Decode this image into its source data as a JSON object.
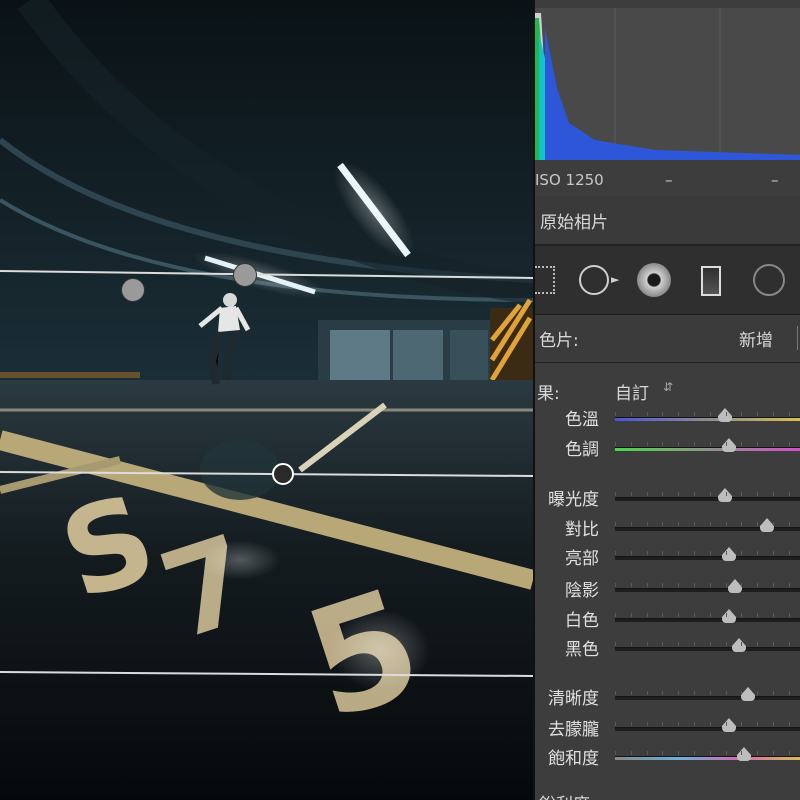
{
  "photo": {
    "description": "",
    "guide_handles": 4
  },
  "panel": {
    "histogram": {
      "colors": [
        "#1fb84e",
        "#14c3c8",
        "#2d57d8",
        "#e0e0e0"
      ]
    },
    "exif": {
      "iso": "ISO 1250",
      "dash1": "–",
      "dash2": "–"
    },
    "original_photo_label": "原始相片",
    "tools": [
      "crop-icon",
      "spot-removal-icon",
      "red-eye-icon",
      "graduated-filter-icon",
      "radial-filter-icon"
    ],
    "preset_label": "色片:",
    "preset_new": "新增",
    "effect_label": "果:",
    "effect_value": "自訂",
    "sliders": {
      "temp": {
        "label": "色溫",
        "value": 0.58
      },
      "tint": {
        "label": "色調",
        "value": 0.6
      },
      "exposure": {
        "label": "曝光度",
        "value": 0.58
      },
      "contrast": {
        "label": "對比",
        "value": 0.8
      },
      "highlights": {
        "label": "亮部",
        "value": 0.6
      },
      "shadows": {
        "label": "陰影",
        "value": 0.63
      },
      "whites": {
        "label": "白色",
        "value": 0.6
      },
      "blacks": {
        "label": "黑色",
        "value": 0.65
      },
      "clarity": {
        "label": "清晰度",
        "value": 0.7
      },
      "dehaze": {
        "label": "去朦朧",
        "value": 0.6
      },
      "saturation": {
        "label": "飽和度",
        "value": 0.68
      }
    },
    "cut_label": "銳利度"
  }
}
